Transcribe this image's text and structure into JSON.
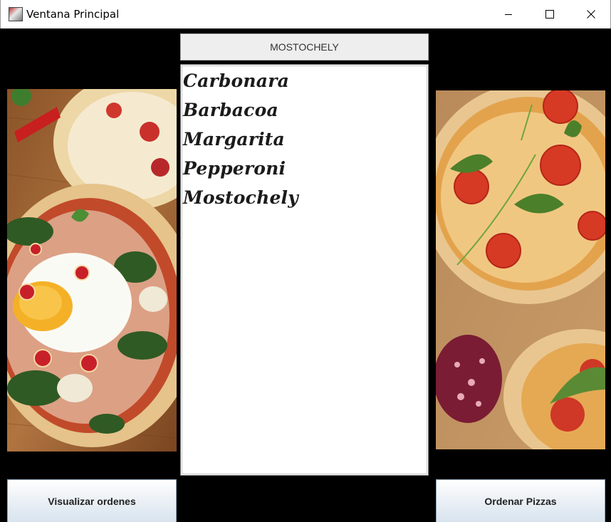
{
  "window": {
    "title": "Ventana Principal"
  },
  "header": {
    "label": "MOSTOCHELY"
  },
  "pizza_list": {
    "items": [
      "Carbonara",
      "Barbacoa",
      "Margarita",
      "Pepperoni",
      "Mostochely"
    ]
  },
  "buttons": {
    "view_orders": "Visualizar ordenes",
    "order_pizzas": "Ordenar Pizzas"
  },
  "icons": {
    "app": "java-app-icon",
    "minimize": "minimize-icon",
    "maximize": "maximize-icon",
    "close": "close-icon"
  },
  "colors": {
    "background": "#000000",
    "header_button": "#eeeeee",
    "list_background": "#ffffff"
  }
}
